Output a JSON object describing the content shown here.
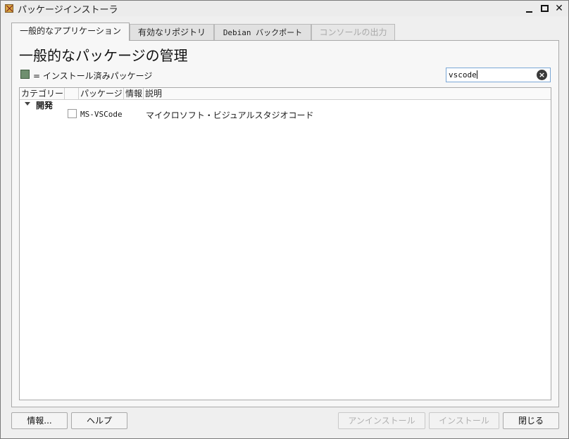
{
  "window": {
    "title": "パッケージインストーラ"
  },
  "tabs": [
    {
      "label": "一般的なアプリケーション",
      "state": "active"
    },
    {
      "label": "有効なリポジトリ",
      "state": "normal"
    },
    {
      "label": "Debian バックポート",
      "state": "normal"
    },
    {
      "label": "コンソールの出力",
      "state": "disabled"
    }
  ],
  "page": {
    "heading": "一般的なパッケージの管理",
    "legend_text": "= インストール済みパッケージ",
    "legend_color": "#6f8f6f"
  },
  "search": {
    "value": "vscode"
  },
  "table": {
    "columns": [
      "カテゴリー",
      "",
      "パッケージ",
      "情報",
      "説明"
    ],
    "categories": [
      {
        "name": "開発",
        "expanded": true,
        "packages": [
          {
            "name": "MS-VSCode",
            "installed": false,
            "description": "マイクロソフト・ビジュアルスタジオコード"
          }
        ]
      }
    ]
  },
  "buttons": {
    "info": "情報...",
    "help": "ヘルプ",
    "uninstall": "アンインストール",
    "install": "インストール",
    "close": "閉じる"
  },
  "icons": {
    "app": "package-installer-icon",
    "clear": "clear-icon",
    "expander": "expander-down-icon"
  }
}
